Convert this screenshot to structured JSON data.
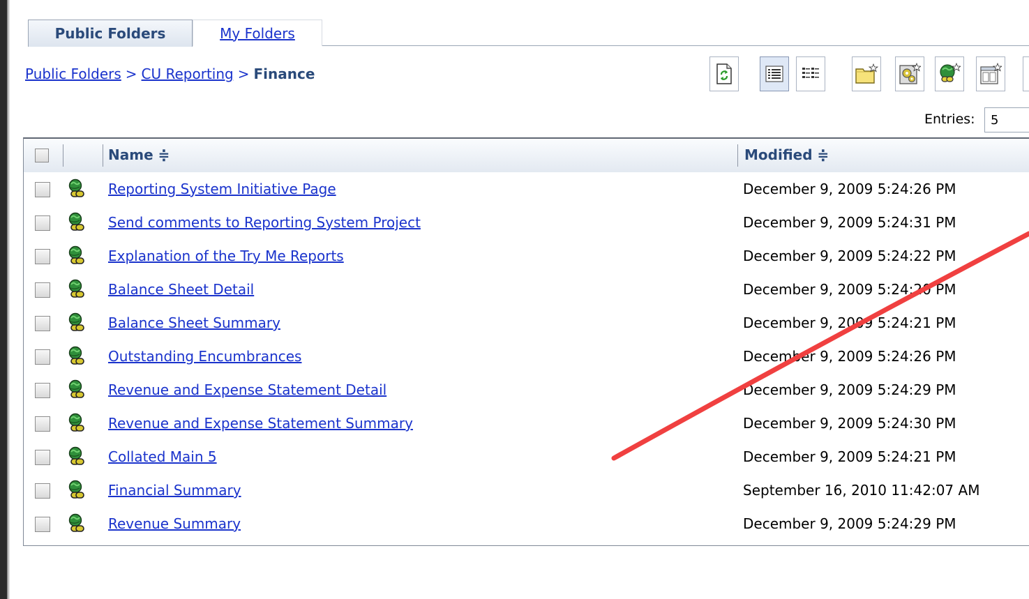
{
  "tabs": [
    {
      "label": "Public Folders",
      "active": true
    },
    {
      "label": "My Folders",
      "active": false
    }
  ],
  "breadcrumb": {
    "items": [
      "Public Folders",
      "CU Reporting"
    ],
    "current": "Finance",
    "separator": ">"
  },
  "toolbar": [
    {
      "icon": "refresh-icon"
    },
    {
      "icon": "details-view-icon",
      "pressed": true
    },
    {
      "icon": "list-view-icon"
    },
    {
      "icon": "new-folder-icon"
    },
    {
      "icon": "new-job-icon"
    },
    {
      "icon": "new-url-icon"
    },
    {
      "icon": "new-page-icon"
    }
  ],
  "entries": {
    "label": "Entries:",
    "value": "5"
  },
  "table": {
    "columns": {
      "name": "Name ≑",
      "modified": "Modified ≑"
    },
    "rows": [
      {
        "name": "Reporting System Initiative Page",
        "modified": "December 9, 2009 5:24:26 PM"
      },
      {
        "name": "Send comments to Reporting System Project",
        "modified": "December 9, 2009 5:24:31 PM"
      },
      {
        "name": "Explanation of the Try Me Reports",
        "modified": "December 9, 2009 5:24:22 PM"
      },
      {
        "name": "Balance Sheet Detail",
        "modified": "December 9, 2009 5:24:20 PM"
      },
      {
        "name": "Balance Sheet Summary",
        "modified": "December 9, 2009 5:24:21 PM"
      },
      {
        "name": "Outstanding Encumbrances",
        "modified": "December 9, 2009 5:24:26 PM"
      },
      {
        "name": "Revenue and Expense Statement Detail",
        "modified": "December 9, 2009 5:24:29 PM"
      },
      {
        "name": "Revenue and Expense Statement Summary",
        "modified": "December 9, 2009 5:24:30 PM"
      },
      {
        "name": "Collated Main 5",
        "modified": "December 9, 2009 5:24:21 PM"
      },
      {
        "name": "Financial Summary",
        "modified": "September 16, 2010 11:42:07 AM"
      },
      {
        "name": "Revenue Summary",
        "modified": "December 9, 2009 5:24:29 PM"
      }
    ]
  },
  "colors": {
    "link": "#1a33cc",
    "header_text": "#2a4a7a",
    "annotation": "#f04040"
  }
}
